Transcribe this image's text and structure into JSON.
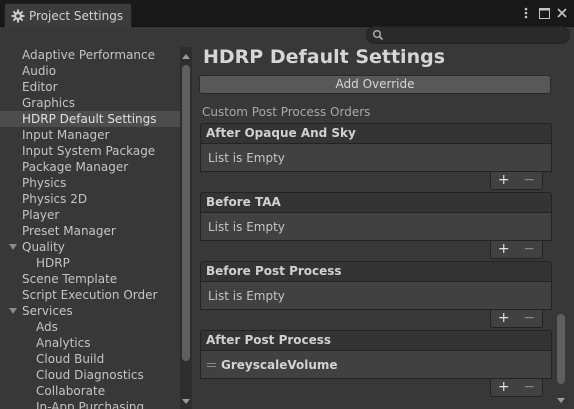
{
  "window": {
    "tab_title": "Project Settings",
    "tab_icon": "gear-icon",
    "controls": [
      "more-icon",
      "maximize-icon",
      "close-icon"
    ]
  },
  "search": {
    "placeholder": "",
    "value": ""
  },
  "sidebar": {
    "items": [
      {
        "label": "Adaptive Performance",
        "child": false,
        "selected": false,
        "expandable": false
      },
      {
        "label": "Audio",
        "child": false,
        "selected": false,
        "expandable": false
      },
      {
        "label": "Editor",
        "child": false,
        "selected": false,
        "expandable": false
      },
      {
        "label": "Graphics",
        "child": false,
        "selected": false,
        "expandable": false
      },
      {
        "label": "HDRP Default Settings",
        "child": false,
        "selected": true,
        "expandable": false
      },
      {
        "label": "Input Manager",
        "child": false,
        "selected": false,
        "expandable": false
      },
      {
        "label": "Input System Package",
        "child": false,
        "selected": false,
        "expandable": false
      },
      {
        "label": "Package Manager",
        "child": false,
        "selected": false,
        "expandable": false
      },
      {
        "label": "Physics",
        "child": false,
        "selected": false,
        "expandable": false
      },
      {
        "label": "Physics 2D",
        "child": false,
        "selected": false,
        "expandable": false
      },
      {
        "label": "Player",
        "child": false,
        "selected": false,
        "expandable": false
      },
      {
        "label": "Preset Manager",
        "child": false,
        "selected": false,
        "expandable": false
      },
      {
        "label": "Quality",
        "child": false,
        "selected": false,
        "expandable": true
      },
      {
        "label": "HDRP",
        "child": true,
        "selected": false,
        "expandable": false
      },
      {
        "label": "Scene Template",
        "child": false,
        "selected": false,
        "expandable": false
      },
      {
        "label": "Script Execution Order",
        "child": false,
        "selected": false,
        "expandable": false
      },
      {
        "label": "Services",
        "child": false,
        "selected": false,
        "expandable": true
      },
      {
        "label": "Ads",
        "child": true,
        "selected": false,
        "expandable": false
      },
      {
        "label": "Analytics",
        "child": true,
        "selected": false,
        "expandable": false
      },
      {
        "label": "Cloud Build",
        "child": true,
        "selected": false,
        "expandable": false
      },
      {
        "label": "Cloud Diagnostics",
        "child": true,
        "selected": false,
        "expandable": false
      },
      {
        "label": "Collaborate",
        "child": true,
        "selected": false,
        "expandable": false
      },
      {
        "label": "In-App Purchasing",
        "child": true,
        "selected": false,
        "expandable": false
      }
    ]
  },
  "main": {
    "title": "HDRP Default Settings",
    "add_override_label": "Add Override",
    "section_label": "Custom Post Process Orders",
    "lists": [
      {
        "header": "After Opaque And Sky",
        "empty_text": "List is Empty",
        "items": []
      },
      {
        "header": "Before TAA",
        "empty_text": "List is Empty",
        "items": []
      },
      {
        "header": "Before Post Process",
        "empty_text": "List is Empty",
        "items": []
      },
      {
        "header": "After Post Process",
        "empty_text": "",
        "items": [
          "GreyscaleVolume"
        ]
      }
    ],
    "plus_label": "+",
    "minus_label": "−"
  }
}
